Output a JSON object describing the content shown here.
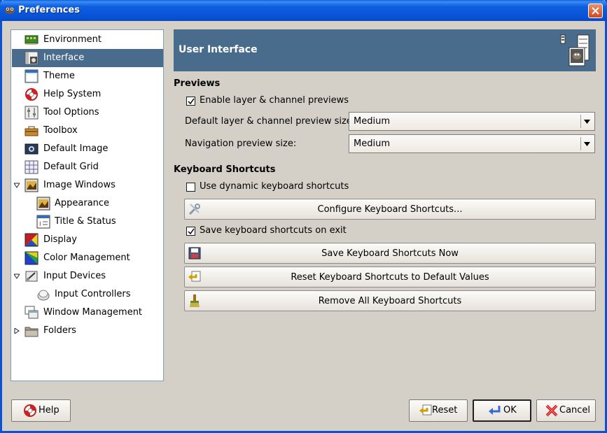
{
  "window": {
    "title": "Preferences"
  },
  "tree": {
    "items": [
      {
        "label": "Environment",
        "icon": "environment-icon"
      },
      {
        "label": "Interface",
        "icon": "interface-icon"
      },
      {
        "label": "Theme",
        "icon": "theme-icon"
      },
      {
        "label": "Help System",
        "icon": "lifebuoy-icon"
      },
      {
        "label": "Tool Options",
        "icon": "tool-options-icon"
      },
      {
        "label": "Toolbox",
        "icon": "toolbox-icon"
      },
      {
        "label": "Default Image",
        "icon": "default-image-icon"
      },
      {
        "label": "Default Grid",
        "icon": "default-grid-icon"
      },
      {
        "label": "Image Windows",
        "icon": "image-windows-icon"
      },
      {
        "label": "Appearance",
        "icon": "appearance-icon"
      },
      {
        "label": "Title & Status",
        "icon": "title-status-icon"
      },
      {
        "label": "Display",
        "icon": "display-icon"
      },
      {
        "label": "Color Management",
        "icon": "color-management-icon"
      },
      {
        "label": "Input Devices",
        "icon": "input-devices-icon"
      },
      {
        "label": "Input Controllers",
        "icon": "input-controllers-icon"
      },
      {
        "label": "Window Management",
        "icon": "window-management-icon"
      },
      {
        "label": "Folders",
        "icon": "folders-icon"
      }
    ],
    "selected": "Interface"
  },
  "banner": {
    "title": "User Interface"
  },
  "previews": {
    "heading": "Previews",
    "enable_label": "Enable layer & channel previews",
    "enable_checked": true,
    "default_size_label": "Default layer & channel preview size:",
    "default_size_value": "Medium",
    "nav_size_label": "Navigation preview size:",
    "nav_size_value": "Medium"
  },
  "shortcuts": {
    "heading": "Keyboard Shortcuts",
    "dynamic_label": "Use dynamic keyboard shortcuts",
    "dynamic_checked": false,
    "configure_label": "Configure Keyboard Shortcuts...",
    "save_on_exit_label": "Save keyboard shortcuts on exit",
    "save_on_exit_checked": true,
    "save_now_label": "Save Keyboard Shortcuts Now",
    "reset_label": "Reset Keyboard Shortcuts to Default Values",
    "remove_label": "Remove All Keyboard Shortcuts"
  },
  "buttons": {
    "help": "Help",
    "reset": "Reset",
    "ok": "OK",
    "cancel": "Cancel"
  },
  "colors": {
    "selection": "#4a6c8c",
    "titlebar": "#0752d6"
  }
}
